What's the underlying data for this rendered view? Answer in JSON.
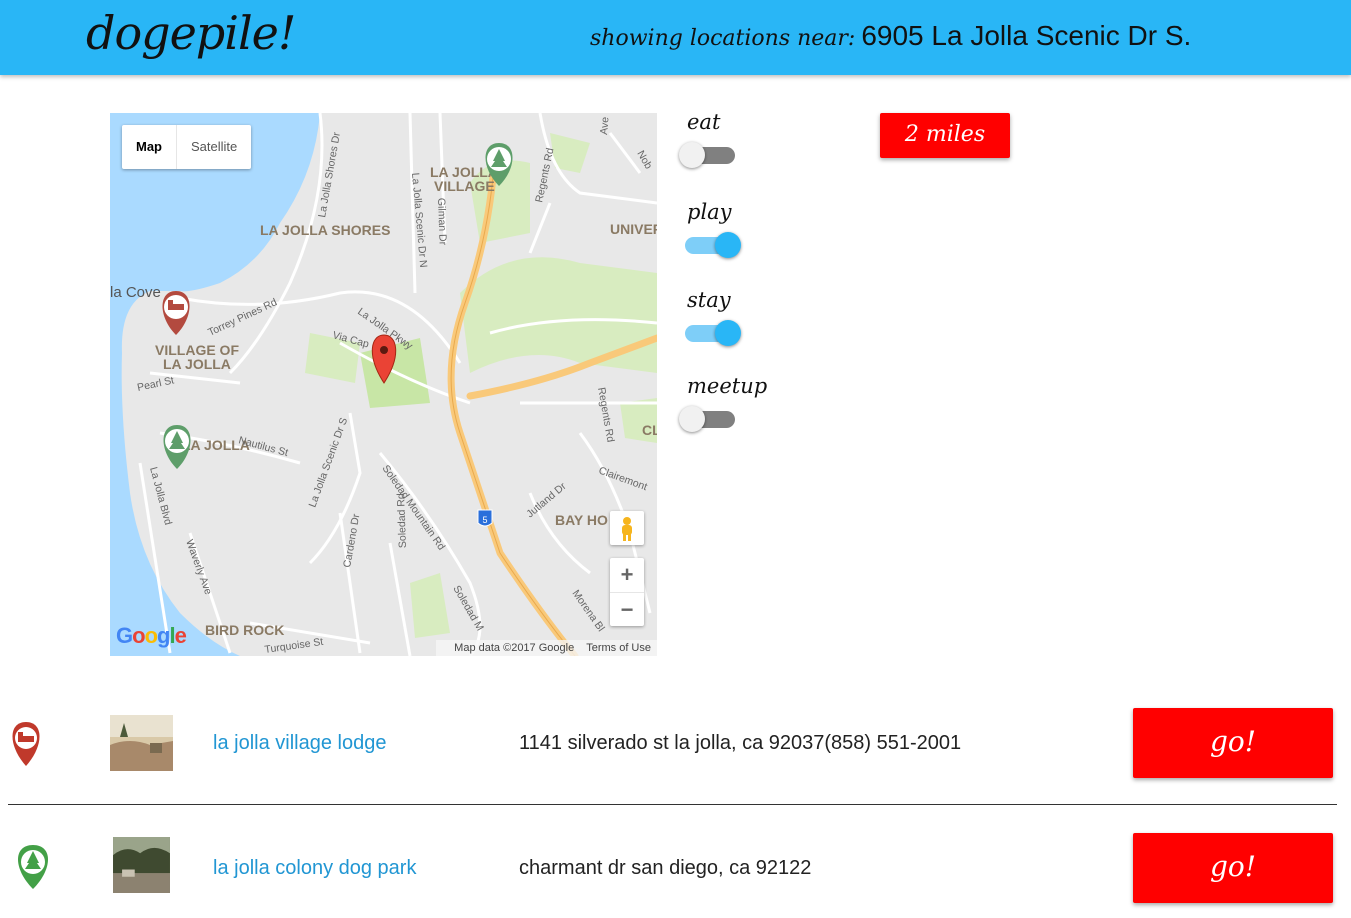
{
  "header": {
    "logo": "dogepile!",
    "near_label": "showing locations near:",
    "near_address": "6905 La Jolla Scenic Dr S."
  },
  "map": {
    "type_map": "Map",
    "type_satellite": "Satellite",
    "google": "Google",
    "attribution": "Map data ©2017 Google",
    "terms": "Terms of Use",
    "zoom_in": "+",
    "zoom_out": "−",
    "place_labels": {
      "la_jolla_village": [
        "LA JOLLA",
        "VILLAGE"
      ],
      "la_jolla_shores": "LA JOLLA SHORES",
      "village_of_la_jolla": [
        "VILLAGE OF",
        "LA JOLLA"
      ],
      "la_jolla": "LA JOLLA",
      "la_cove": "la Cove",
      "bay_ho": "BAY HO",
      "bird_rock": "BIRD ROCK",
      "univer": "UNIVER",
      "cl": "CL"
    },
    "road_labels": [
      "La Jolla Shores Dr",
      "La Jolla Scenic Dr N",
      "Gilman Dr",
      "Regents Rd",
      "Torrey Pines Rd",
      "La Jolla Pkwy",
      "Via Cap",
      "Pearl St",
      "Nautilus St",
      "La Jolla Scenic Dr S",
      "Soledad Mountain Rd",
      "La Jolla Blvd",
      "Waverly Ave",
      "Cardeno Dr",
      "Soledad Rd",
      "Jutland Dr",
      "Clairemont",
      "Morena Bl",
      "Turquoise St",
      "5",
      "Ave",
      "Nob",
      "Soledad M",
      "Regents Rd",
      "Mora"
    ]
  },
  "filters": [
    {
      "label": "eat",
      "on": false
    },
    {
      "label": "play",
      "on": true
    },
    {
      "label": "stay",
      "on": true
    },
    {
      "label": "meetup",
      "on": false
    }
  ],
  "distance_button": "2 miles",
  "results": [
    {
      "icon": "lodging-pin-icon",
      "icon_color": "#c0392b",
      "name": "la jolla village lodge",
      "address": "1141 silverado st la jolla, ca 92037",
      "phone": "(858) 551-2001",
      "go": "go!"
    },
    {
      "icon": "park-pin-icon",
      "icon_color": "#43a047",
      "name": "la jolla colony dog park",
      "address": "charmant dr san diego, ca 92122",
      "phone": "",
      "go": "go!"
    }
  ],
  "colors": {
    "header": "#29b6f6",
    "button": "#ff0000",
    "link": "#2196d3",
    "toggle_on": "#29b6f6",
    "toggle_off": "#808080"
  }
}
